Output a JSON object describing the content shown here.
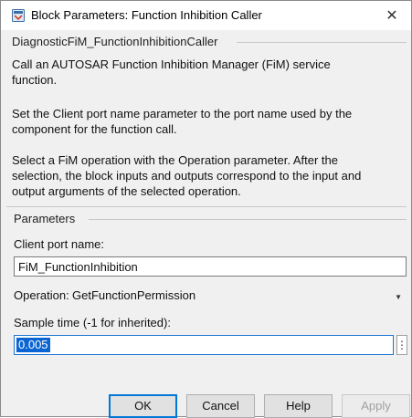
{
  "window": {
    "title": "Block Parameters: Function Inhibition Caller",
    "close_glyph": "✕",
    "app_icon": "simulink-block-icon"
  },
  "block_name": "DiagnosticFiM_FunctionInhibitionCaller",
  "description": [
    "Call an AUTOSAR Function Inhibition Manager (FiM) service",
    "function.",
    "Set the Client port name parameter to the port name used by the",
    "component for the function call.",
    "Select a FiM operation with the Operation parameter.  After the",
    "selection, the block inputs and outputs correspond to the input and",
    "output arguments of the selected operation."
  ],
  "parameters": {
    "legend": "Parameters",
    "client_port": {
      "label": "Client port name:",
      "value": "FiM_FunctionInhibition"
    },
    "operation": {
      "label": "Operation:",
      "value": "GetFunctionPermission",
      "caret": "▼"
    },
    "sample_time": {
      "label": "Sample time (-1 for inherited):",
      "value": "0.005",
      "more_glyph": "⋮"
    }
  },
  "buttons": {
    "ok": "OK",
    "cancel": "Cancel",
    "help": "Help",
    "apply": "Apply"
  },
  "colors": {
    "selection": "#0a64d2",
    "focus_border": "#1976d2",
    "default_button_border": "#0078d7"
  }
}
